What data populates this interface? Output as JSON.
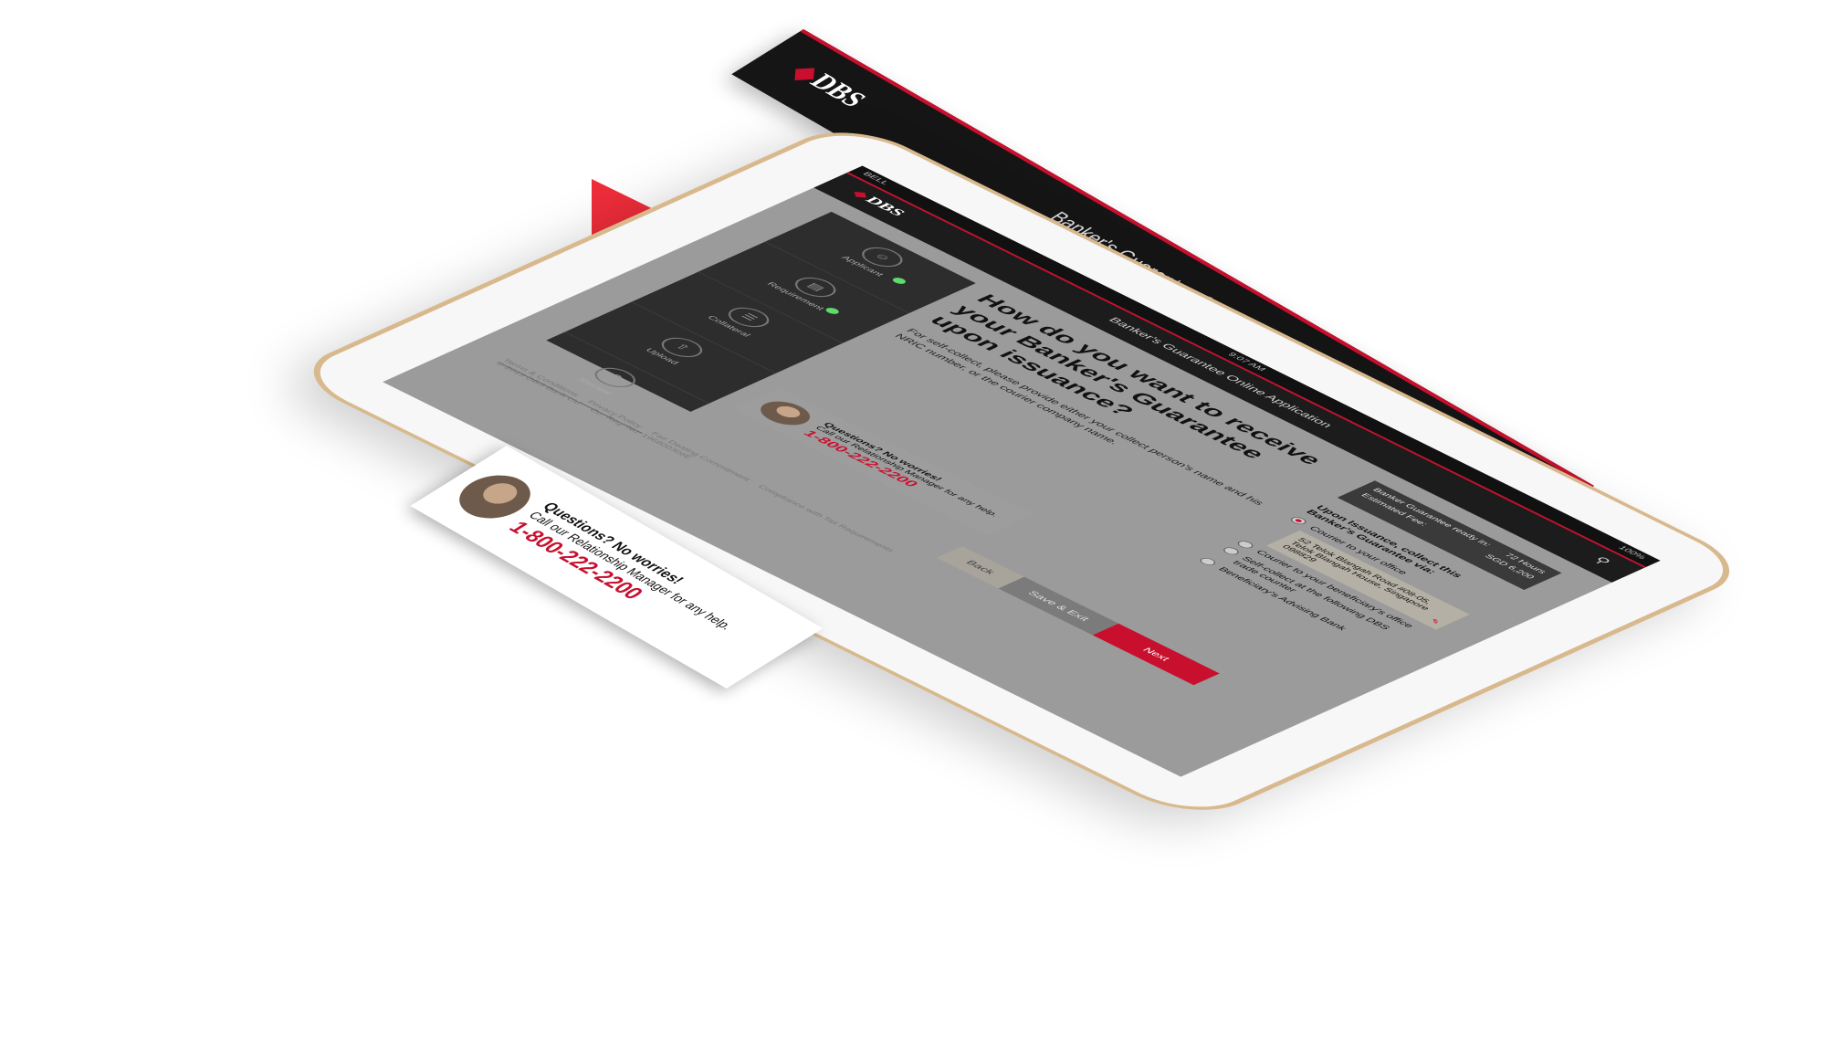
{
  "banner": {
    "logo": "DBS",
    "title": "Banker's Guarantee Online Application",
    "search_icon": "search-icon"
  },
  "device": {
    "status": {
      "carrier": "BELL",
      "time": "9:07 AM",
      "battery": "100%"
    }
  },
  "app": {
    "logo": "DBS",
    "title": "Banker's Guarantee Online Application"
  },
  "steps": [
    {
      "label": "Applicant",
      "icon": "user-icon"
    },
    {
      "label": "Requirement",
      "icon": "document-icon"
    },
    {
      "label": "Collateral",
      "icon": "stack-icon"
    },
    {
      "label": "Upload",
      "icon": "upload-icon"
    },
    {
      "label": "Review",
      "icon": "search-icon"
    }
  ],
  "main": {
    "question": "How do you want to receive your Banker's Guarantee upon issuance?",
    "hint": "For self-collect, please provide either your collect person's name and his NRIC number, or the courier company name."
  },
  "estimate": {
    "ready_label": "Banker Guarantee ready in:",
    "ready_value": "72 Hours",
    "fee_label": "Estimated Fee:",
    "fee_value": "SGD 6,200"
  },
  "delivery": {
    "heading": "Upon Issuance, collect this Banker's Guarantee via:",
    "options": [
      "Courier to your office",
      "Courier to your beneficiary's office",
      "Self-collect at the following DBS trade counter",
      "Beneficiary's Advising Bank"
    ],
    "address": "52 Telok Blangah Road #08-05, Telok Blangah House, Singapore 098829"
  },
  "help": {
    "question": "Questions? No worries!",
    "subtitle": "Call our Relationship Manager for any help.",
    "phone": "1-800-222-2200"
  },
  "actions": {
    "back": "Back",
    "save": "Save & Exit",
    "next": "Next"
  },
  "footer": {
    "links": [
      "Terms & Conditions",
      "Privacy Policy",
      "Fair Dealing Commitment",
      "Compliance with Tax Requirements"
    ],
    "copyright": "© 2013 DBS Bank Ltd",
    "reg": "Co. Reg. No. 196800306E"
  },
  "colors": {
    "brand_red": "#c8102e",
    "accent_green": "#5edb6d",
    "dark": "#1c1c1c"
  }
}
